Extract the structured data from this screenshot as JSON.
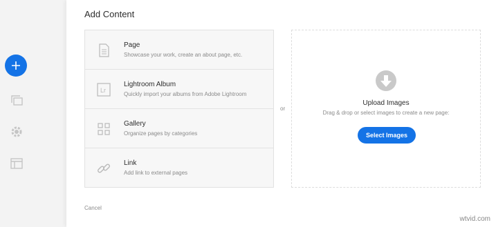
{
  "dialog": {
    "title": "Add Content",
    "or_label": "or",
    "cancel_label": "Cancel"
  },
  "options": [
    {
      "label": "Page",
      "description": "Showcase your work, create an about page, etc.",
      "icon": "page-icon"
    },
    {
      "label": "Lightroom Album",
      "description": "Quickly import your albums from Adobe Lightroom",
      "icon": "lightroom-icon"
    },
    {
      "label": "Gallery",
      "description": "Organize pages by categories",
      "icon": "gallery-grid-icon"
    },
    {
      "label": "Link",
      "description": "Add link to external pages",
      "icon": "link-icon"
    }
  ],
  "upload": {
    "title": "Upload Images",
    "description": "Drag & drop or select images to create a new page:",
    "button_label": "Select Images",
    "icon": "download-arrow-icon"
  },
  "sidebar": {
    "icons": [
      "add-icon",
      "pages-stack-icon",
      "gear-icon",
      "layout-icon"
    ]
  },
  "watermark": "wtvid.com",
  "colors": {
    "accent": "#1473e6",
    "background": "#f3f3f3"
  }
}
